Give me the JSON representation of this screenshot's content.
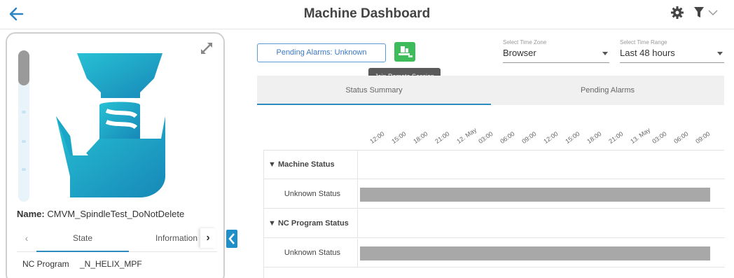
{
  "header": {
    "title": "Machine Dashboard"
  },
  "machine": {
    "name_label": "Name:",
    "name_value": "CMVM_SpindleTest_DoNotDelete",
    "tabs": [
      "State",
      "Information"
    ],
    "state_rows": [
      {
        "label": "NC Program",
        "value": "_N_HELIX_MPF"
      }
    ]
  },
  "toolbar": {
    "pending_alarms_label": "Pending Alarms:  Unknown",
    "remote_session_tooltip": "Join Remote Session"
  },
  "time_zone": {
    "label": "Select Time Zone",
    "value": "Browser"
  },
  "time_range": {
    "label": "Select Time Range",
    "value": "Last 48 hours"
  },
  "tabs": {
    "status_summary": "Status Summary",
    "pending_alarms": "Pending Alarms"
  },
  "timeline": {
    "ticks": [
      "12:00",
      "15:00",
      "18:00",
      "21:00",
      "12. May",
      "03:00",
      "06:00",
      "09:00",
      "12:00",
      "15:00",
      "18:00",
      "21:00",
      "13. May",
      "03:00",
      "06:00",
      "09:00"
    ]
  },
  "status_groups": [
    {
      "group": "▼ Machine Status",
      "item": "Unknown Status"
    },
    {
      "group": "▼ NC Program Status",
      "item": "Unknown Status"
    }
  ],
  "colors": {
    "accent": "#2e8bc0",
    "machine_icon": "#1eb1c8",
    "remote_button": "#3ebb5a",
    "status_bar": "#a8a8a8"
  }
}
